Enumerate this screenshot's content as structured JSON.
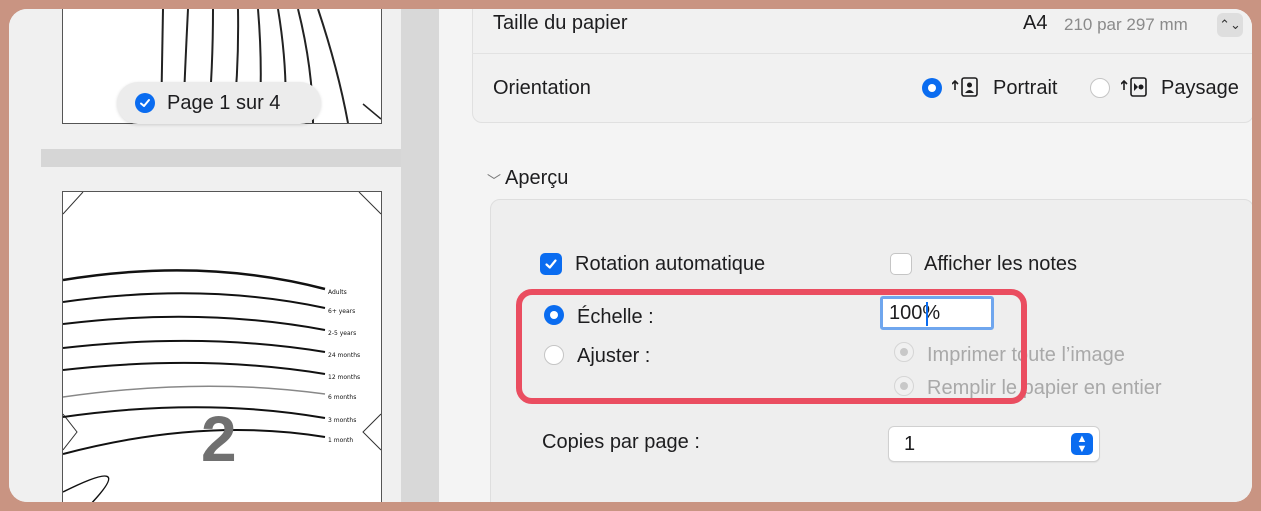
{
  "preview": {
    "page_badge": "Page 1 sur 4",
    "page_number_glyph": "2",
    "chart_labels": [
      "Adults",
      "6+ years",
      "2-5 years",
      "24 months",
      "12 months",
      "6 months",
      "3 months",
      "1 month"
    ]
  },
  "paper": {
    "label": "Taille du papier",
    "value": "A4",
    "dims": "210 par 297 mm"
  },
  "orientation": {
    "label": "Orientation",
    "portrait": "Portrait",
    "landscape": "Paysage",
    "selected": "portrait"
  },
  "apercu": {
    "title": "Aperçu",
    "auto_rotate": "Rotation automatique",
    "show_notes": "Afficher les notes",
    "scale_label": "Échelle :",
    "scale_value": "100%",
    "fit_label": "Ajuster :",
    "print_whole": "Imprimer toute l’image",
    "fill_paper": "Remplir le papier en entier",
    "copies_label": "Copies par page :",
    "copies_value": "1"
  },
  "colors": {
    "accent": "#0a6cf0",
    "highlight": "#ea4d60",
    "frame": "#c99482"
  }
}
